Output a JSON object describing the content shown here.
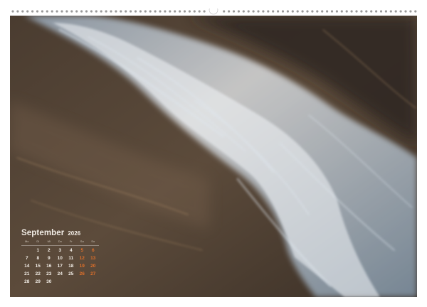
{
  "calendar": {
    "month": "September",
    "year": "2026",
    "weekdays": [
      "Mo",
      "Di",
      "Mi",
      "Do",
      "Fr",
      "Sa",
      "So"
    ],
    "leading_blanks": 1,
    "days": [
      "1",
      "2",
      "3",
      "4",
      "5",
      "6",
      "7",
      "8",
      "9",
      "10",
      "11",
      "12",
      "13",
      "14",
      "15",
      "16",
      "17",
      "18",
      "19",
      "20",
      "21",
      "22",
      "23",
      "24",
      "25",
      "26",
      "27",
      "28",
      "29",
      "30"
    ]
  },
  "colors": {
    "weekend_accent": "#e0702a",
    "sand": "#5a4a3a",
    "foam": "#e8eef5",
    "page_background": "#ffffff"
  },
  "photo": {
    "subject": "wave-icon"
  }
}
